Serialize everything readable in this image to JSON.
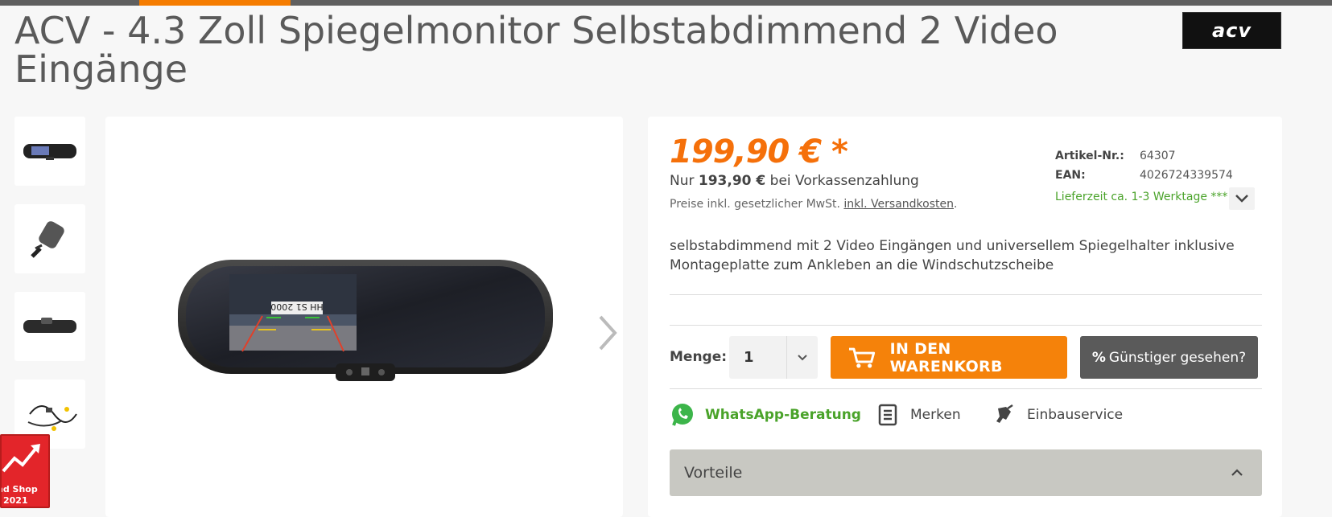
{
  "product": {
    "title": "ACV - 4.3 Zoll Spiegelmonitor Selbstabdimmend 2 Video Eingänge",
    "brand_logo_text": "acv"
  },
  "pricing": {
    "price": "199,90 € *",
    "prepay_prefix": "Nur ",
    "prepay_amount": "193,90 €",
    "prepay_suffix": " bei Vorkassenzahlung",
    "tax_text": "Preise inkl. gesetzlicher MwSt. ",
    "shipping_link": "inkl. Versandkosten",
    "tax_suffix": "."
  },
  "meta": {
    "article_label": "Artikel-Nr.:",
    "article_value": "64307",
    "ean_label": "EAN:",
    "ean_value": "4026724339574",
    "delivery": "Lieferzeit ca. 1-3 Werktage ***"
  },
  "description": "selbstabdimmend mit 2 Video Eingängen und universellem Spiegelhalter inklusive Montageplatte zum Ankleben an die Windschutzscheibe",
  "purchase": {
    "qty_label": "Menge:",
    "qty_value": "1",
    "cart_label": "IN DEN WARENKORB",
    "cheaper_symbol": "%",
    "cheaper_label": "Günstiger gesehen?"
  },
  "actions": {
    "whatsapp": "WhatsApp-Beratung",
    "remember": "Merken",
    "install": "Einbauservice"
  },
  "accordion": {
    "vorteile": "Vorteile"
  },
  "badge": {
    "line1": "nd Shop",
    "line2": "2021"
  },
  "colors": {
    "accent": "#f5820a",
    "price": "#f5700a",
    "delivery": "#4aa32a",
    "whatsapp": "#4aa32a"
  }
}
